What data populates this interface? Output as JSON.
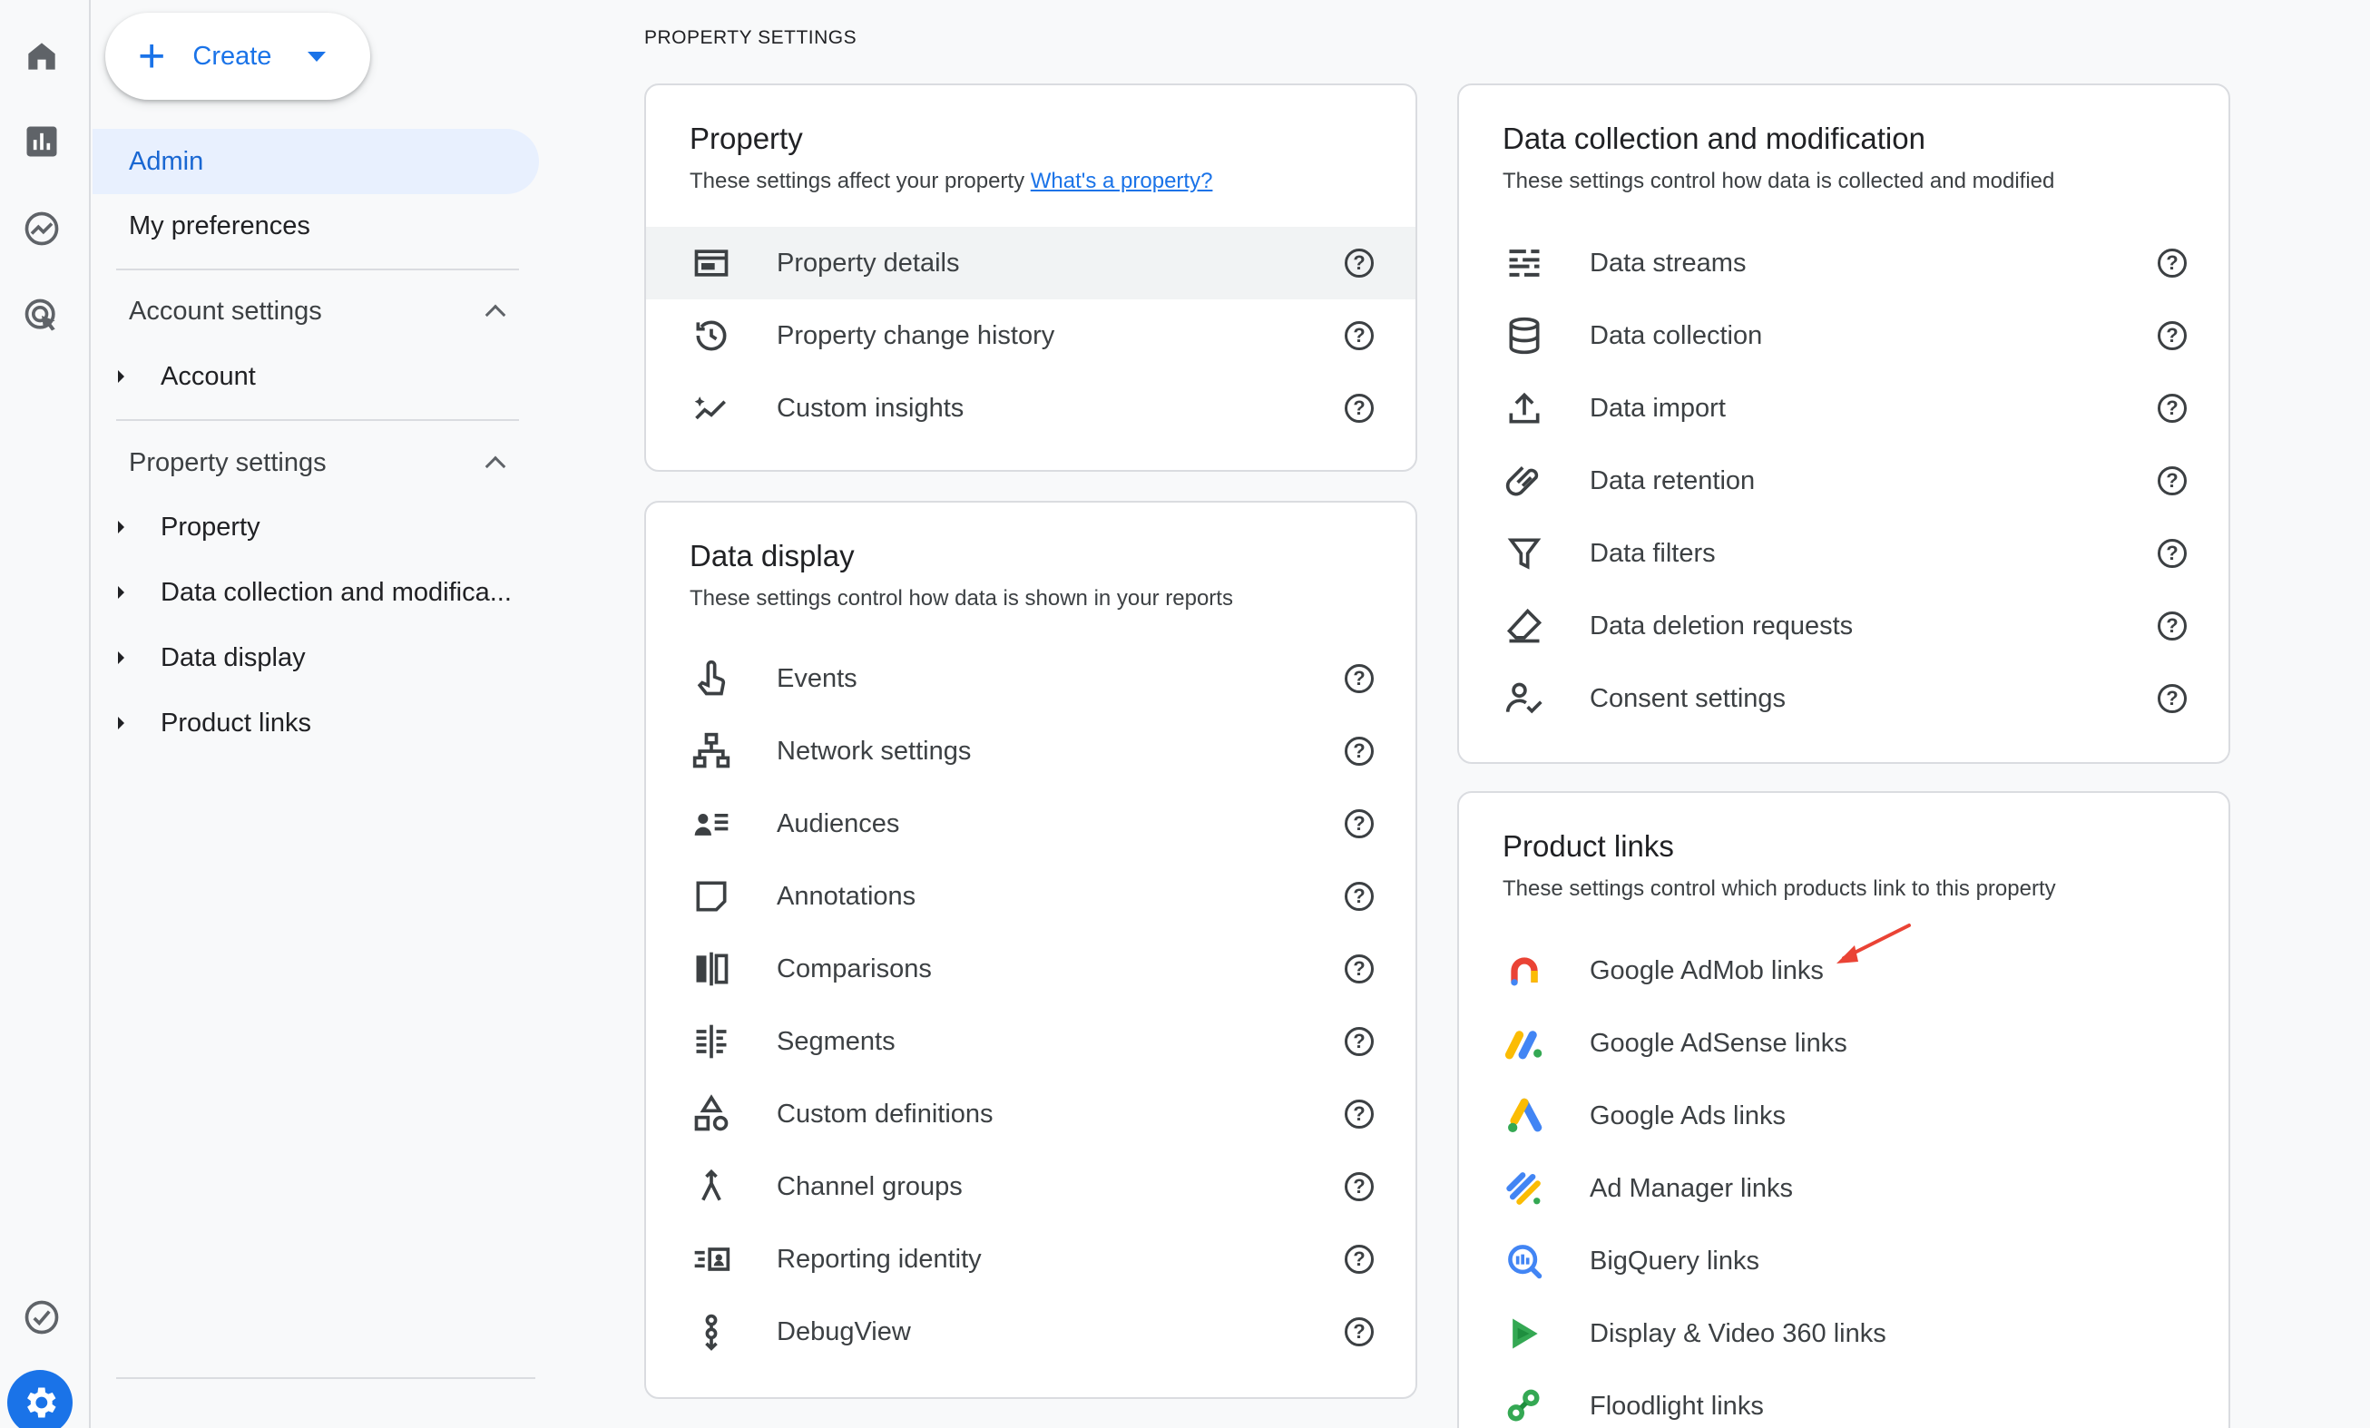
{
  "create_button": {
    "label": "Create"
  },
  "sidenav": {
    "admin": "Admin",
    "my_preferences": "My preferences",
    "account_settings": {
      "label": "Account settings",
      "items": [
        "Account"
      ]
    },
    "property_settings": {
      "label": "Property settings",
      "items": [
        "Property",
        "Data collection and modifica...",
        "Data display",
        "Product links"
      ]
    }
  },
  "page_heading": "PROPERTY SETTINGS",
  "cards": {
    "property": {
      "title": "Property",
      "desc": "These settings affect your property ",
      "link": "What's a property?",
      "rows": [
        {
          "label": "Property details",
          "icon": "property-details-icon"
        },
        {
          "label": "Property change history",
          "icon": "history-icon"
        },
        {
          "label": "Custom insights",
          "icon": "insights-icon"
        }
      ]
    },
    "data_display": {
      "title": "Data display",
      "desc": "These settings control how data is shown in your reports",
      "rows": [
        {
          "label": "Events",
          "icon": "touch-icon"
        },
        {
          "label": "Network settings",
          "icon": "network-icon"
        },
        {
          "label": "Audiences",
          "icon": "audiences-icon"
        },
        {
          "label": "Annotations",
          "icon": "note-icon"
        },
        {
          "label": "Comparisons",
          "icon": "comparisons-icon"
        },
        {
          "label": "Segments",
          "icon": "segments-icon"
        },
        {
          "label": "Custom definitions",
          "icon": "shapes-icon"
        },
        {
          "label": "Channel groups",
          "icon": "merge-icon"
        },
        {
          "label": "Reporting identity",
          "icon": "identity-icon"
        },
        {
          "label": "DebugView",
          "icon": "debug-icon"
        }
      ]
    },
    "data_collection": {
      "title": "Data collection and modification",
      "desc": "These settings control how data is collected and modified",
      "rows": [
        {
          "label": "Data streams",
          "icon": "streams-icon"
        },
        {
          "label": "Data collection",
          "icon": "database-icon"
        },
        {
          "label": "Data import",
          "icon": "upload-icon"
        },
        {
          "label": "Data retention",
          "icon": "paperclip-icon"
        },
        {
          "label": "Data filters",
          "icon": "filter-icon"
        },
        {
          "label": "Data deletion requests",
          "icon": "eraser-icon"
        },
        {
          "label": "Consent settings",
          "icon": "consent-icon"
        }
      ]
    },
    "product_links": {
      "title": "Product links",
      "desc": "These settings control which products link to this property",
      "rows": [
        {
          "label": "Google AdMob links",
          "icon": "admob-icon"
        },
        {
          "label": "Google AdSense links",
          "icon": "adsense-icon"
        },
        {
          "label": "Google Ads links",
          "icon": "google-ads-icon"
        },
        {
          "label": "Ad Manager links",
          "icon": "ad-manager-icon"
        },
        {
          "label": "BigQuery links",
          "icon": "bigquery-icon"
        },
        {
          "label": "Display & Video 360 links",
          "icon": "dv360-icon"
        },
        {
          "label": "Floodlight links",
          "icon": "floodlight-icon"
        }
      ]
    }
  },
  "help_glyph": "?",
  "colors": {
    "accent": "#1a73e8",
    "annotation_arrow": "#ea4335"
  }
}
